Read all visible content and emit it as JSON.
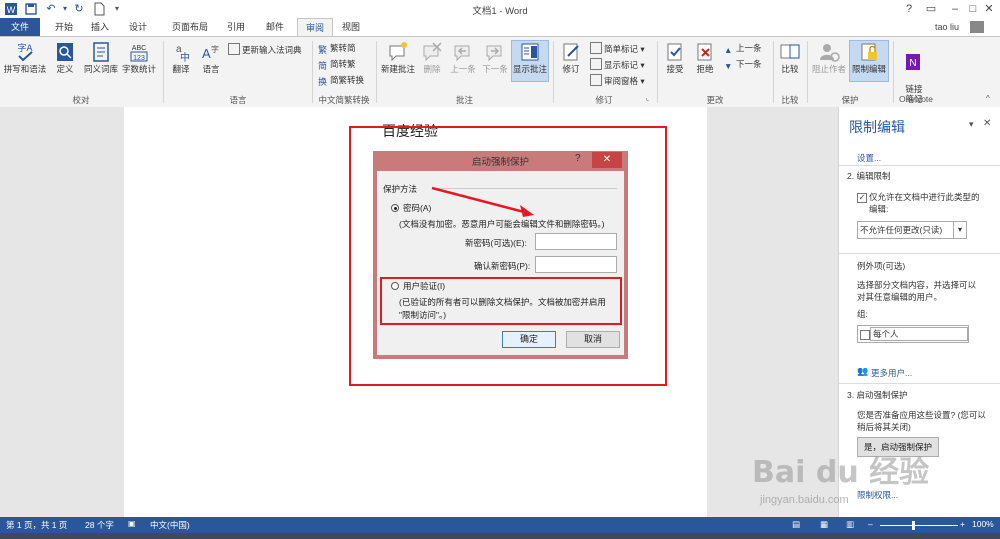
{
  "window": {
    "title": "文档1 - Word",
    "help": "?"
  },
  "tabs": [
    "文件",
    "开始",
    "插入",
    "设计",
    "页面布局",
    "引用",
    "邮件",
    "审阅",
    "视图"
  ],
  "user": "tao liu",
  "ribbon": {
    "proofing": {
      "spelling": "拼写和语法",
      "define": "定义",
      "thesaurus": "同义词库",
      "wordcount": "字数统计",
      "group": "校对"
    },
    "language": {
      "translate": "翻译",
      "language": "语言",
      "update_ime": "更新输入法词典",
      "group": "语言"
    },
    "chinese": {
      "to_trad": "繁转简",
      "to_simp": "简转繁",
      "convert": "简繁转换",
      "group": "中文简繁转换"
    },
    "comments": {
      "new": "新建批注",
      "delete": "删除",
      "prev": "上一条",
      "next": "下一条",
      "show": "显示批注",
      "group": "批注"
    },
    "tracking": {
      "track": "修订",
      "simple": "简单标记",
      "show_markup": "显示标记",
      "review_pane": "审阅窗格",
      "group": "修订"
    },
    "changes": {
      "accept": "接受",
      "reject": "拒绝",
      "prev": "上一条",
      "next": "下一条",
      "group": "更改"
    },
    "compare": {
      "compare": "比较",
      "group": "比较"
    },
    "protect": {
      "block": "阻止作者",
      "restrict": "限制编辑",
      "group": "保护"
    },
    "onenote": {
      "linked": "链接\n笔记",
      "group": "OneNote"
    }
  },
  "document": {
    "text": "百度经验"
  },
  "dialog": {
    "title": "启动强制保护",
    "section": "保护方法",
    "password_option": "密码(A)",
    "password_desc": "(文档没有加密。恶意用户可能会编辑文件和删除密码。)",
    "new_password_label": "新密码(可选)(E):",
    "confirm_password_label": "确认新密码(P):",
    "user_auth_option": "用户验证(I)",
    "user_auth_desc1": "(已验证的所有者可以删除文档保护。文档被加密并启用",
    "user_auth_desc2": "\"限制访问\"。)",
    "ok": "确定",
    "cancel": "取消"
  },
  "pane": {
    "title": "限制编辑",
    "settings_link": "设置...",
    "section2": "2. 编辑限制",
    "allow_checkbox": "仅允许在文档中进行此类型的",
    "allow_checkbox2": "编辑:",
    "edit_type": "不允许任何更改(只读)",
    "exceptions": "例外项(可选)",
    "exceptions_desc1": "选择部分文档内容，并选择可以",
    "exceptions_desc2": "对其任意编辑的用户。",
    "groups_label": "组:",
    "everyone": "每个人",
    "more_users": "更多用户...",
    "section3": "3. 启动强制保护",
    "section3_desc1": "您是否准备应用这些设置? (您可以",
    "section3_desc2": "稍后将其关闭)",
    "start_button": "是，启动强制保护",
    "restrict_perm": "限制权限..."
  },
  "statusbar": {
    "page": "第 1 页，共 1 页",
    "words": "28 个字",
    "lang": "中文(中国)",
    "zoom": "100%"
  },
  "watermark": {
    "logo": "Bai du 经验",
    "url": "jingyan.baidu.com"
  },
  "colors": {
    "accent": "#2b579a",
    "highlight": "#e21b23"
  }
}
